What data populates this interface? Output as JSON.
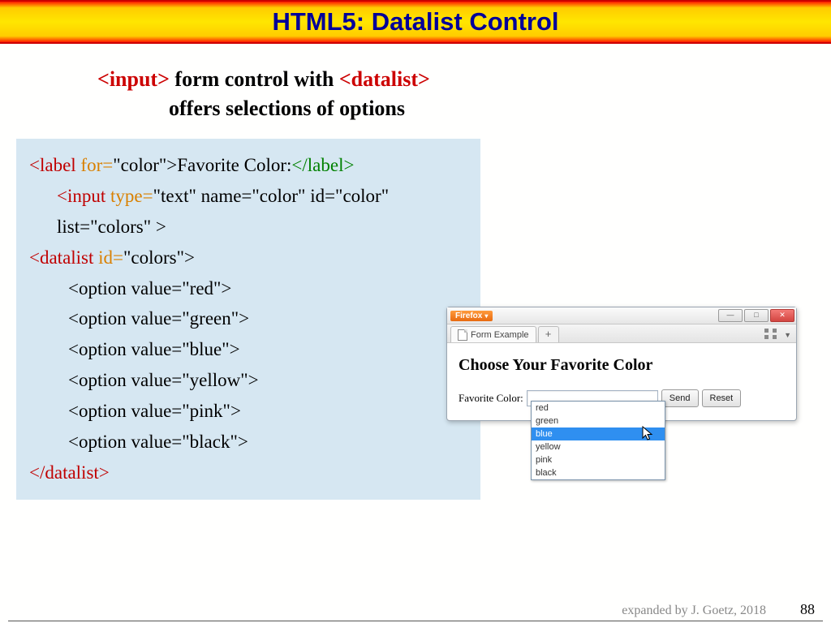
{
  "title": "HTML5: Datalist Control",
  "subtitle": {
    "tag1": "<input>",
    "mid": " form control with ",
    "tag2": "<datalist>",
    "line2": "offers selections of options"
  },
  "code": {
    "label_open": "<label",
    "for_attr": " for=",
    "for_val": "\"color\">",
    "label_text": "Favorite Color:",
    "label_close": "</label>",
    "input_open": "<input",
    "type_attr": " type=",
    "type_val": "\"text\" ",
    "name_attr": "name=\"color\" id=\"color\"",
    "list_attr": "list=\"colors\" >",
    "datalist_open": "<datalist",
    "id_attr": " id=",
    "id_val": "\"colors\">",
    "options": [
      "<option value=\"red\">",
      "<option value=\"green\">",
      "<option value=\"blue\">",
      "<option value=\"yellow\">",
      "<option value=\"pink\">",
      "<option value=\"black\">"
    ],
    "datalist_close": "</datalist>"
  },
  "browser": {
    "brand": "Firefox",
    "tab_title": "Form Example",
    "plus": "+",
    "heading": "Choose Your Favorite Color",
    "field_label": "Favorite Color:",
    "send": "Send",
    "reset": "Reset",
    "dropdown_options": [
      "red",
      "green",
      "blue",
      "yellow",
      "pink",
      "black"
    ],
    "selected_index": 2
  },
  "footer": {
    "credit": "expanded  by J. Goetz, 2018",
    "page": "88"
  }
}
